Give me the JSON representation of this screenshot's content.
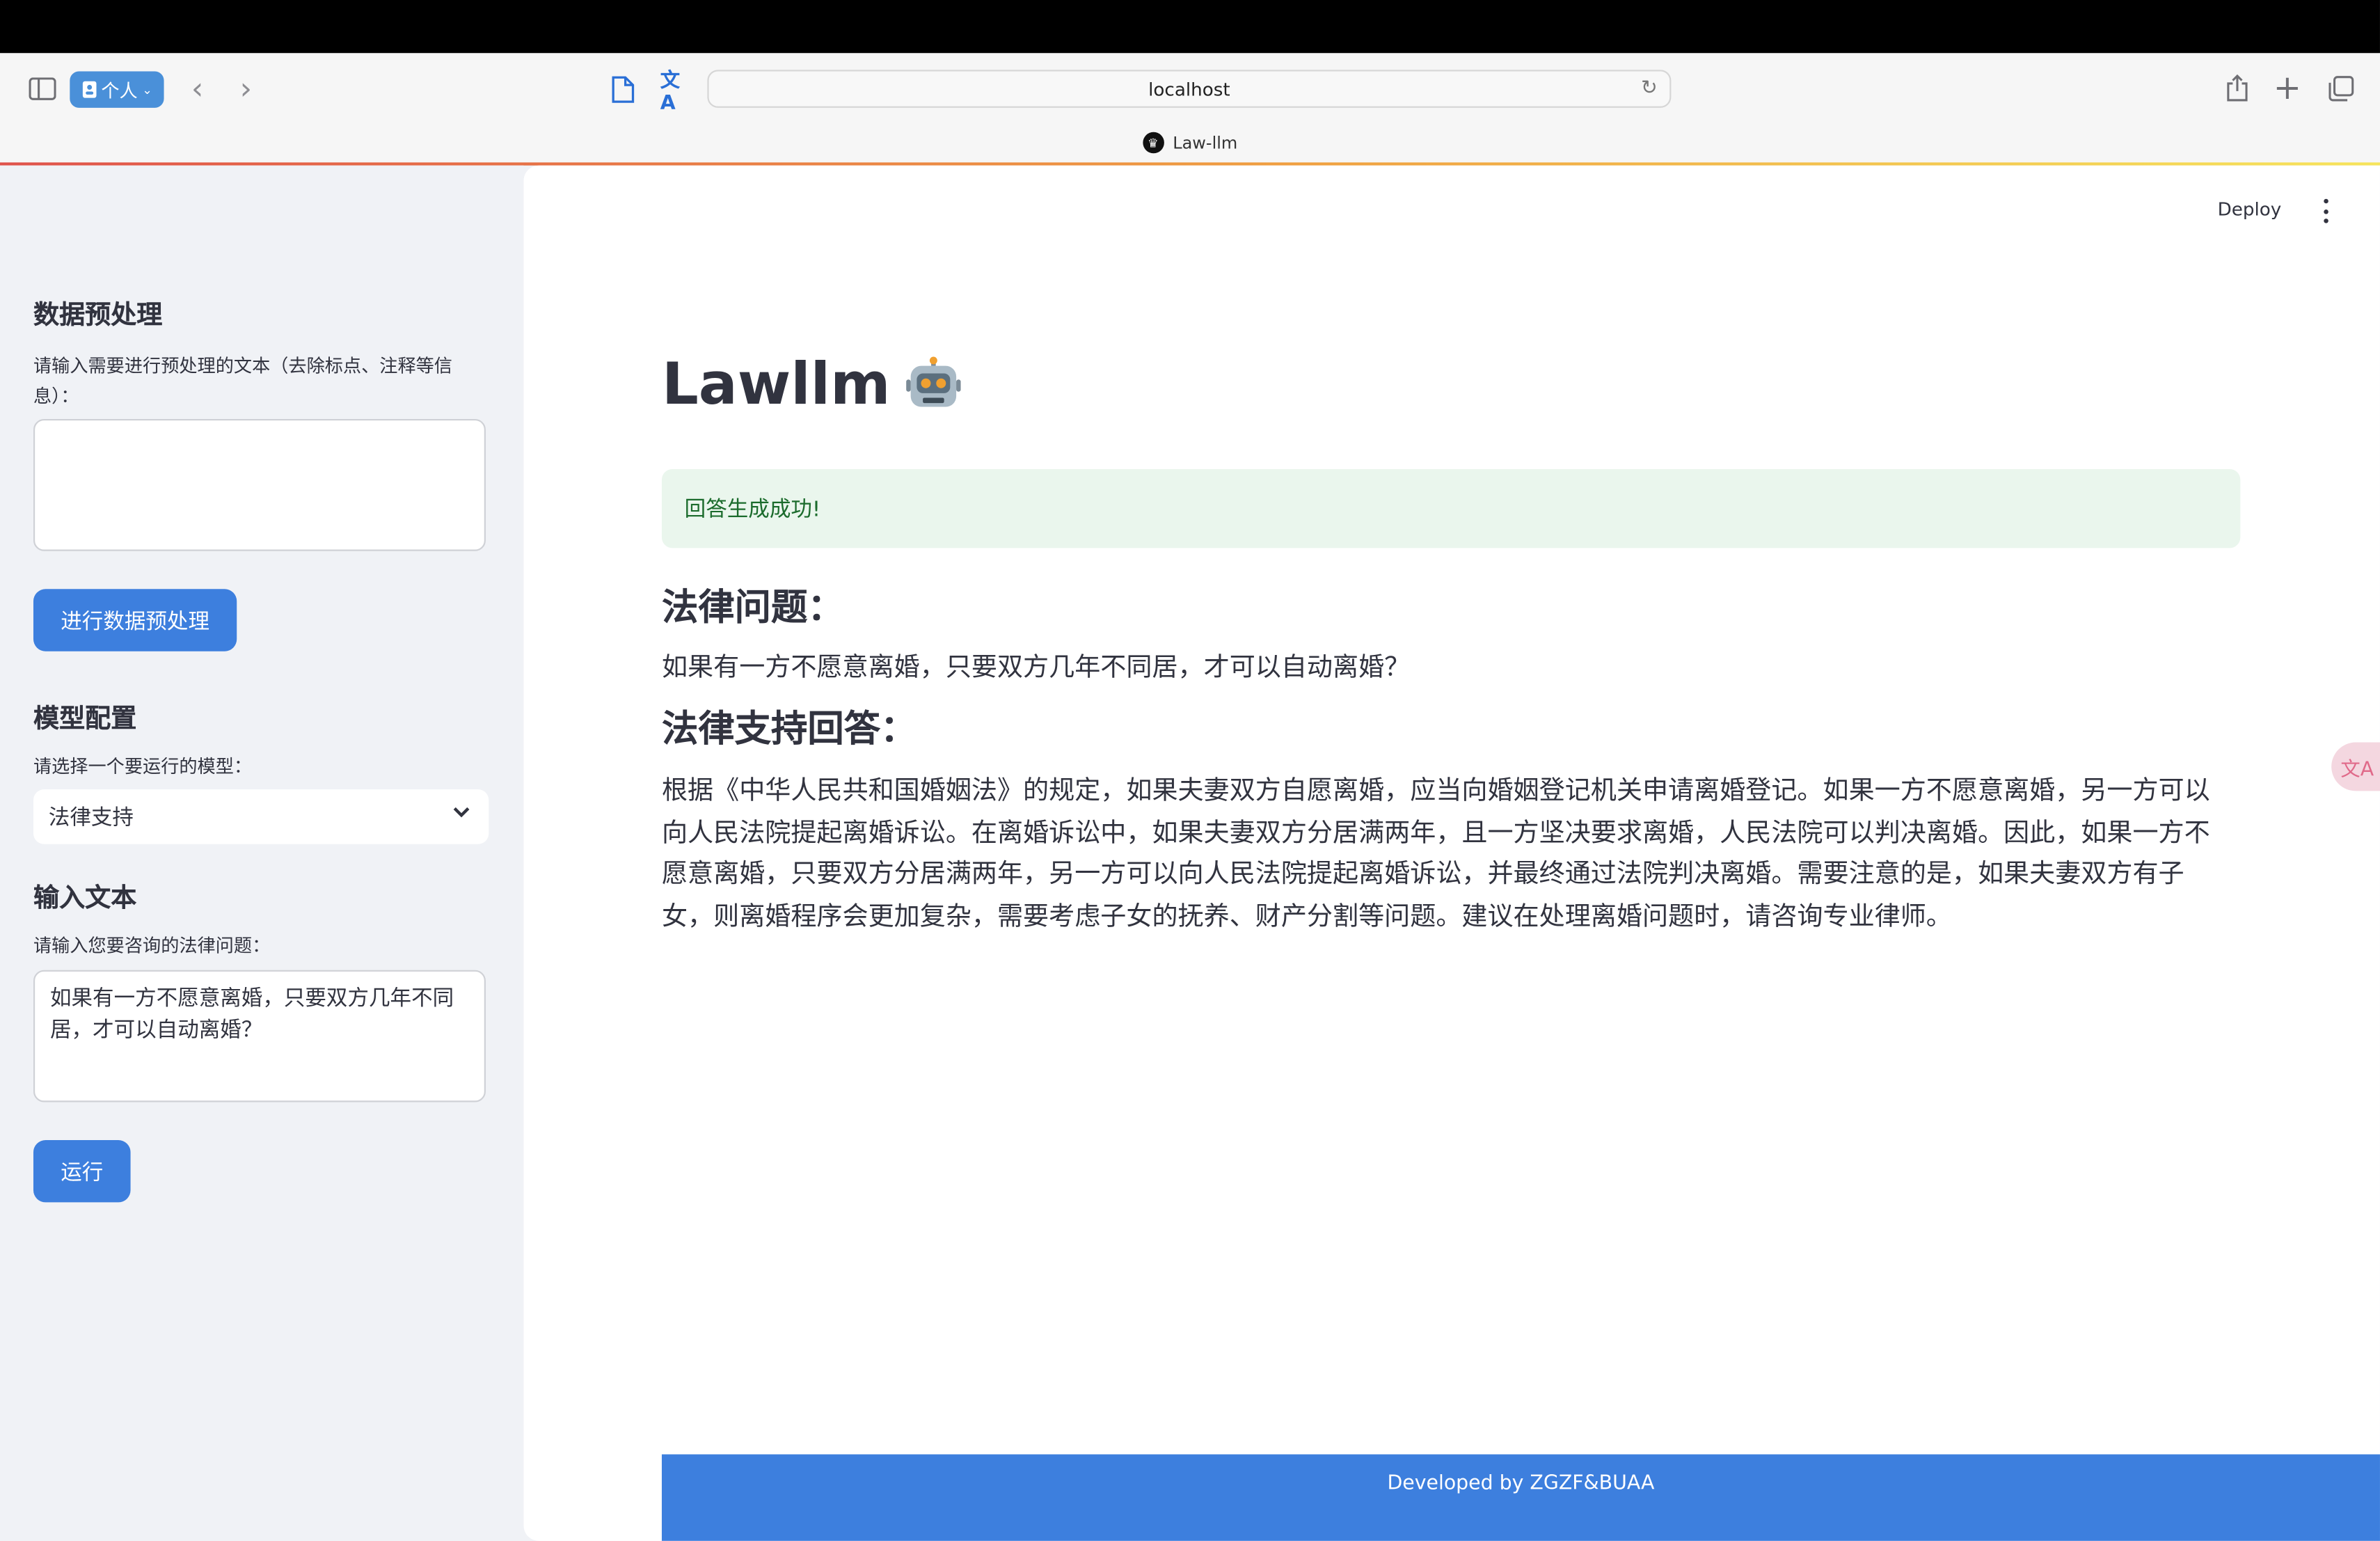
{
  "browser": {
    "profile_label": "个人",
    "address": "localhost",
    "tab_title": "Law-llm"
  },
  "sidebar": {
    "preprocess": {
      "heading": "数据预处理",
      "label": "请输入需要进行预处理的文本（去除标点、注释等信息）：",
      "value": "",
      "button_label": "进行数据预处理"
    },
    "model": {
      "heading": "模型配置",
      "label": "请选择一个要运行的模型：",
      "selected": "法律支持"
    },
    "input": {
      "heading": "输入文本",
      "label": "请输入您要咨询的法律问题：",
      "value": "如果有一方不愿意离婚，只要双方几年不同居，才可以自动离婚？",
      "button_label": "运行"
    }
  },
  "header": {
    "deploy_label": "Deploy"
  },
  "main": {
    "title": "Lawllm",
    "success_message": "回答生成成功!",
    "question_heading": "法律问题：",
    "question_text": "如果有一方不愿意离婚，只要双方几年不同居，才可以自动离婚？",
    "answer_heading": "法律支持回答：",
    "answer_text": "根据《中华人民共和国婚姻法》的规定，如果夫妻双方自愿离婚，应当向婚姻登记机关申请离婚登记。如果一方不愿意离婚，另一方可以向人民法院提起离婚诉讼。在离婚诉讼中，如果夫妻双方分居满两年，且一方坚决要求离婚，人民法院可以判决离婚。因此，如果一方不愿意离婚，只要双方分居满两年，另一方可以向人民法院提起离婚诉讼，并最终通过法院判决离婚。需要注意的是，如果夫妻双方有子女，则离婚程序会更加复杂，需要考虑子女的抚养、财产分割等问题。建议在处理离婚问题时，请咨询专业律师。"
  },
  "footer": {
    "text": "Developed by ZGZF&BUAA"
  },
  "colors": {
    "primary_button": "#3d7fde",
    "success_bg": "#eaf6ed",
    "success_text": "#1b6b2c",
    "sidebar_bg": "#f0f2f6",
    "text": "#31333f"
  }
}
